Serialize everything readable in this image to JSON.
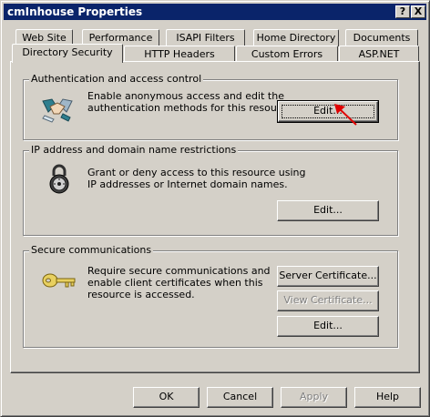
{
  "window": {
    "title": "cmInhouse Properties"
  },
  "titlebar": {
    "help_label": "?",
    "close_label": "X"
  },
  "tabs_back": [
    "Web Site",
    "Performance",
    "ISAPI Filters",
    "Home Directory",
    "Documents"
  ],
  "tabs_front": [
    "Directory Security",
    "HTTP Headers",
    "Custom Errors",
    "ASP.NET"
  ],
  "active_tab": "Directory Security",
  "auth": {
    "title": "Authentication and access control",
    "desc1": "Enable anonymous access and edit the",
    "desc2": "authentication methods for this resource.",
    "edit_label": "Edit...",
    "icon": "handshake-icon"
  },
  "ip": {
    "title": "IP address and domain name restrictions",
    "desc1": "Grant or deny access to this resource using",
    "desc2": "IP addresses or Internet domain names.",
    "edit_label": "Edit...",
    "icon": "lock-icon"
  },
  "secure": {
    "title": "Secure communications",
    "desc1": "Require secure communications and",
    "desc2": "enable client certificates when this",
    "desc3": "resource is accessed.",
    "server_cert_label": "Server Certificate...",
    "view_cert_label": "View Certificate...",
    "edit_label": "Edit...",
    "icon": "key-icon"
  },
  "footer": {
    "ok_label": "OK",
    "cancel_label": "Cancel",
    "apply_label": "Apply",
    "help_label": "Help"
  },
  "colors": {
    "titlebar": "#0a246a",
    "face": "#d4d0c8",
    "arrow": "#e00000"
  }
}
